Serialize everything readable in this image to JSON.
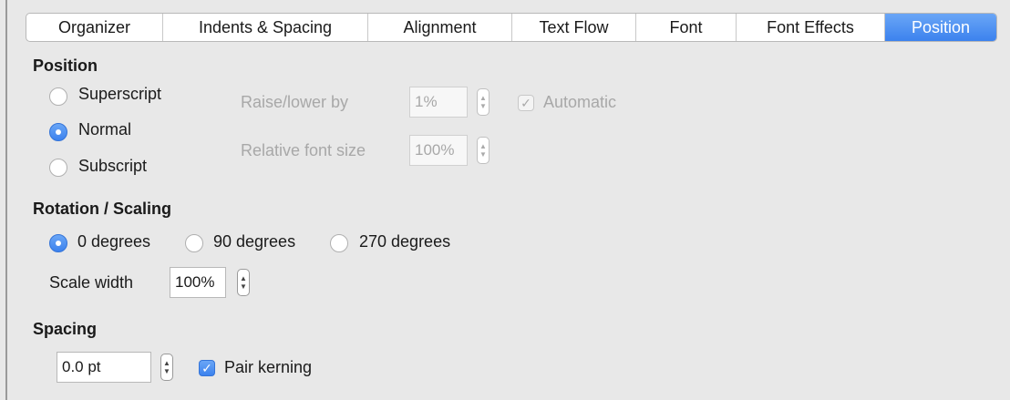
{
  "tabs": [
    {
      "label": "Organizer",
      "active": false
    },
    {
      "label": "Indents & Spacing",
      "active": false
    },
    {
      "label": "Alignment",
      "active": false
    },
    {
      "label": "Text Flow",
      "active": false
    },
    {
      "label": "Font",
      "active": false
    },
    {
      "label": "Font Effects",
      "active": false
    },
    {
      "label": "Position",
      "active": true
    }
  ],
  "position": {
    "heading": "Position",
    "superscript_label": "Superscript",
    "normal_label": "Normal",
    "subscript_label": "Subscript",
    "selected": "Normal",
    "raise_lower_label": "Raise/lower by",
    "raise_lower_value": "1%",
    "automatic_label": "Automatic",
    "automatic_checked": true,
    "relative_size_label": "Relative font size",
    "relative_size_value": "100%"
  },
  "rotation": {
    "heading": "Rotation / Scaling",
    "deg0_label": "0 degrees",
    "deg90_label": "90 degrees",
    "deg270_label": "270 degrees",
    "selected": "0 degrees",
    "scale_width_label": "Scale width",
    "scale_width_value": "100%"
  },
  "spacing": {
    "heading": "Spacing",
    "value": "0.0 pt",
    "pair_kerning_label": "Pair kerning",
    "pair_kerning_checked": true
  },
  "colors": {
    "accent": "#3c82ee",
    "background": "#e8e8e8",
    "disabled_text": "#a8a8a8"
  },
  "icons": {
    "spin": "up-down-spin-icon",
    "check": "checkmark-icon"
  }
}
